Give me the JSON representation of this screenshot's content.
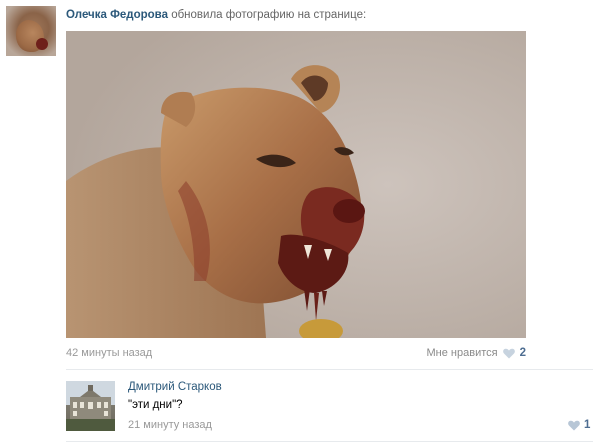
{
  "post": {
    "author": "Олечка Федорова",
    "action": "обновила фотографию на странице:",
    "time": "42 минуты назад",
    "like_label": "Мне нравится",
    "like_count": "2",
    "photo_icon": "lion-photo"
  },
  "comment": {
    "author": "Дмитрий Старков",
    "text": "\"эти дни\"?",
    "time": "21 минуту назад",
    "like_count": "1"
  },
  "colors": {
    "link": "#2b587a",
    "muted": "#999999",
    "heart": "#c7d3df"
  }
}
